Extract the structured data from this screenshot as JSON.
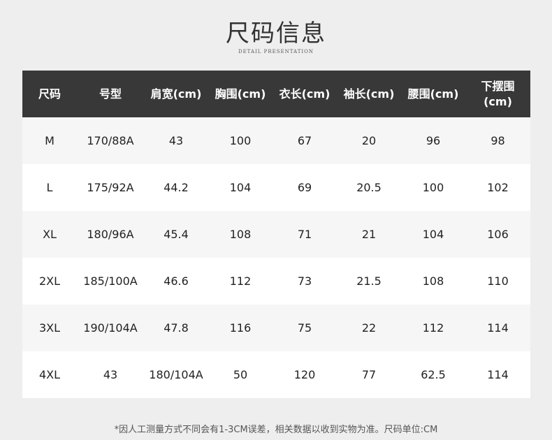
{
  "header": {
    "title": "尺码信息",
    "subtitle": "Detail presentation"
  },
  "table": {
    "columns": [
      "尺码",
      "号型",
      "肩宽(cm)",
      "胸围(cm)",
      "衣长(cm)",
      "袖长(cm)",
      "腰围(cm)",
      "下摆围(cm)"
    ],
    "rows": [
      [
        "M",
        "170/88A",
        "43",
        "100",
        "67",
        "20",
        "96",
        "98"
      ],
      [
        "L",
        "175/92A",
        "44.2",
        "104",
        "69",
        "20.5",
        "100",
        "102"
      ],
      [
        "XL",
        "180/96A",
        "45.4",
        "108",
        "71",
        "21",
        "104",
        "106"
      ],
      [
        "2XL",
        "185/100A",
        "46.6",
        "112",
        "73",
        "21.5",
        "108",
        "110"
      ],
      [
        "3XL",
        "190/104A",
        "47.8",
        "116",
        "75",
        "22",
        "112",
        "114"
      ],
      [
        "4XL",
        "43",
        "180/104A",
        "50",
        "120",
        "77",
        "62.5",
        "114"
      ]
    ]
  },
  "footer": {
    "note": "*因人工测量方式不同会有1-3CM误差，相关数据以收到实物为准。尺码单位:CM"
  }
}
